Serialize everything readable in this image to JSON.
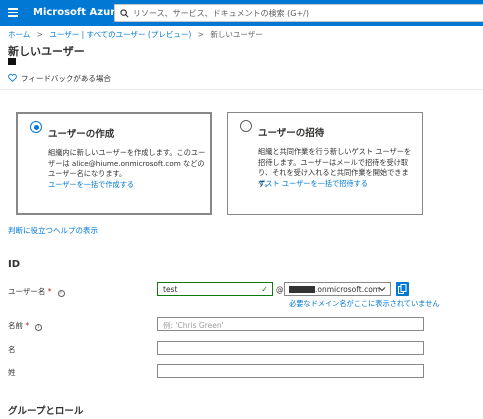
{
  "topbar": {
    "brand": "Microsoft Azure",
    "search_placeholder": "リソース、サービス、ドキュメントの検索 (G+/)"
  },
  "breadcrumb": {
    "items": [
      "ホーム",
      "ユーザー | すべてのユーザー (プレビュー)",
      "新しいユーザー"
    ],
    "separator": ">"
  },
  "page": {
    "title": "新しいユーザー",
    "feedback": "フィードバックがある場合"
  },
  "cards": [
    {
      "title": "ユーザーの作成",
      "description": "組織内に新しいユーザーを作成します。このユーザーは alice@hiume.onmicrosoft.com などのユーザー名になります。",
      "link": "ユーザーを一括で作成する",
      "selected": true
    },
    {
      "title": "ユーザーの招待",
      "description": "組織と共同作業を行う新しいゲスト ユーザーを招待します。ユーザーはメールで招待を受け取り、それを受け入れると共同作業を開始できます。",
      "link": "ゲスト ユーザーを一括で招待する",
      "selected": false
    }
  ],
  "help_link": "判断に役立つヘルプの表示",
  "identity": {
    "section_title": "ID",
    "username": {
      "label": "ユーザー名",
      "required_mark": "*",
      "value": "test",
      "at": "@",
      "domain": ".onmicrosoft.com",
      "domain_link": "必要なドメイン名がここに表示されていません"
    },
    "name": {
      "label": "名前",
      "required_mark": "*",
      "placeholder": "例: 'Chris Green'"
    },
    "first_name": {
      "label": "名"
    },
    "last_name": {
      "label": "姓"
    }
  },
  "groups": {
    "section_title": "グループとロール"
  },
  "colors": {
    "azure_blue": "#0078d4",
    "success_green": "#107c10",
    "required_red": "#a4262c"
  }
}
